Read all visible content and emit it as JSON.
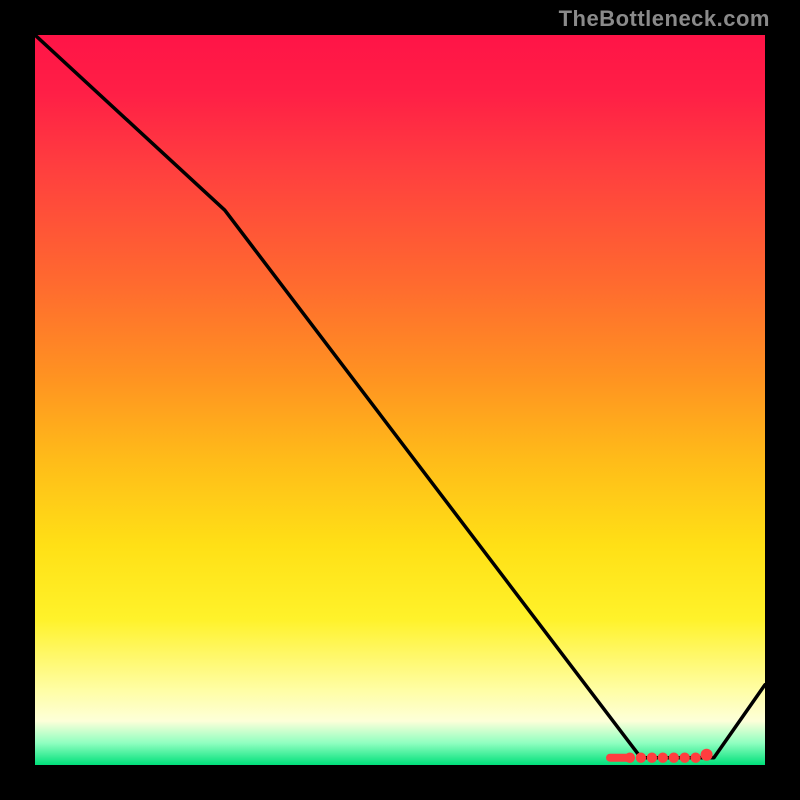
{
  "watermark": "TheBottleneck.com",
  "chart_data": {
    "type": "line",
    "title": "",
    "xlabel": "",
    "ylabel": "",
    "xlim": [
      0,
      100
    ],
    "ylim": [
      0,
      100
    ],
    "grid": false,
    "source_label": "TheBottleneck.com",
    "curve": [
      {
        "x": 0,
        "y": 100
      },
      {
        "x": 26,
        "y": 76
      },
      {
        "x": 83,
        "y": 1
      },
      {
        "x": 93,
        "y": 1
      },
      {
        "x": 100,
        "y": 11
      }
    ],
    "optimum_markers_x": [
      80,
      81.5,
      83,
      84.5,
      86,
      87.5,
      89,
      90.5,
      92
    ],
    "optimum_y": 1,
    "colors": {
      "curve": "#000000",
      "markers": "#ff3e3f",
      "gradient_top": "#ff1447",
      "gradient_bottom": "#00e07a"
    },
    "note": "Values are estimated from pixel positions; axes are unlabeled so a 0–100 normalized scale is used."
  }
}
